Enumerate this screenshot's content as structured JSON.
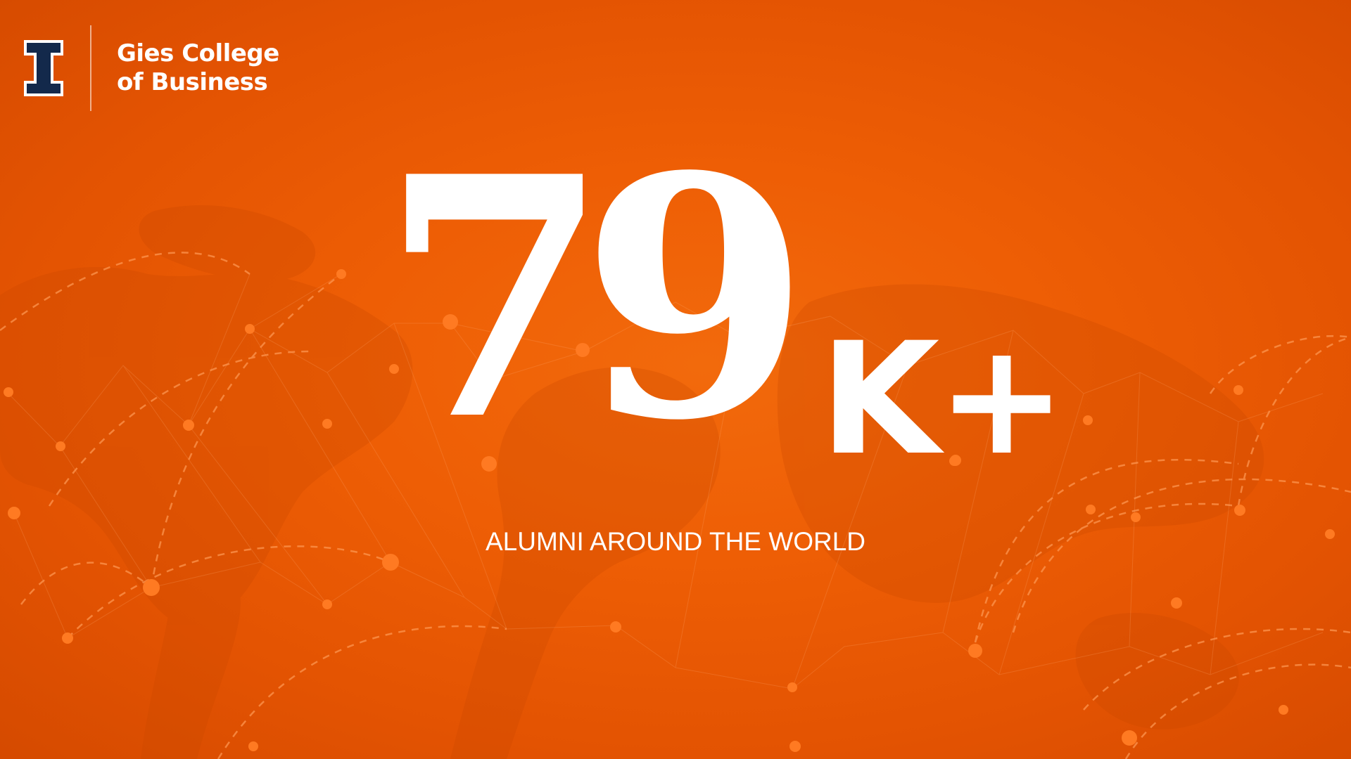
{
  "brand": {
    "logo_icon": "block-i-icon",
    "college_line1": "Gies College",
    "college_line2": "of Business",
    "navy": "#13294b",
    "orange": "#e84a27"
  },
  "stat": {
    "number": "79",
    "suffix": "K+",
    "caption": "ALUMNI AROUND THE WORLD"
  },
  "background": {
    "pattern": "world-map-network",
    "colors": [
      "#f26a0c",
      "#e35302",
      "#ff7a1f"
    ]
  }
}
